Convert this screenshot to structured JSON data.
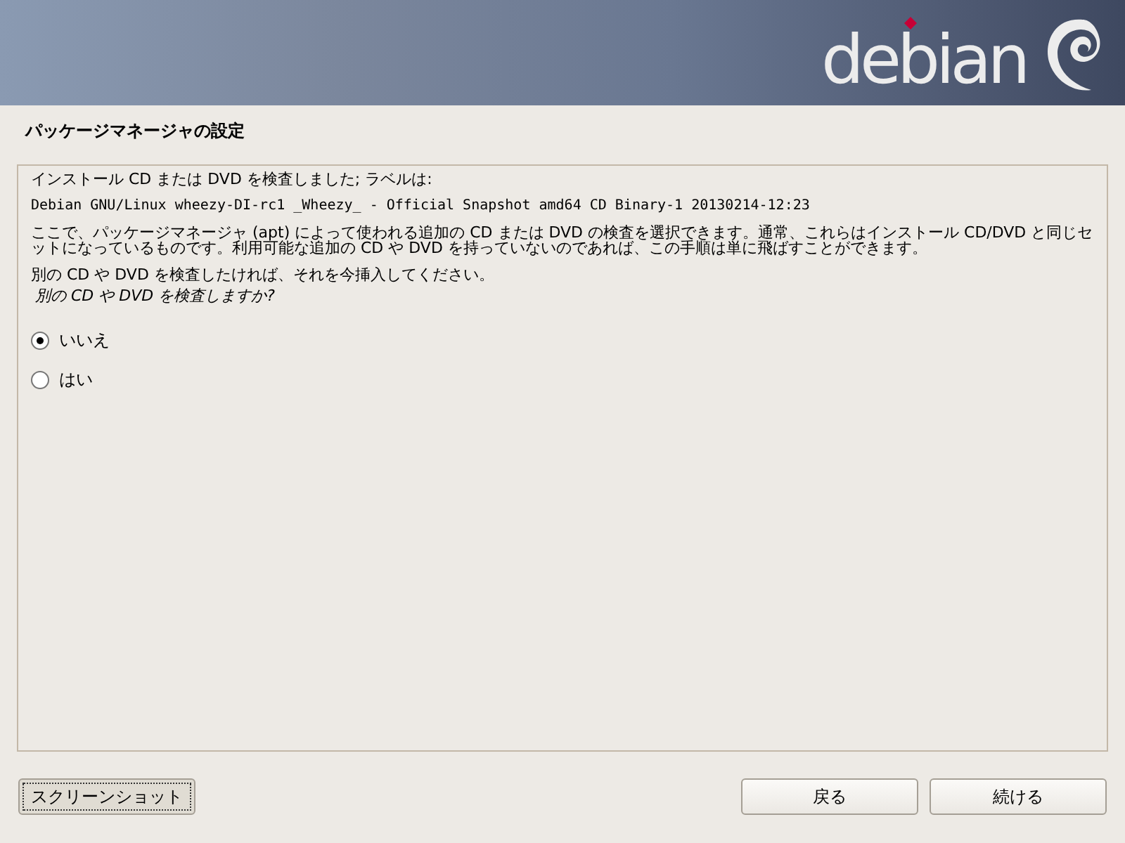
{
  "banner": {
    "logo_text": "debian"
  },
  "title": "パッケージマネージャの設定",
  "content": {
    "lines": [
      "インストール CD または DVD を検査しました; ラベルは:",
      "Debian GNU/Linux wheezy-DI-rc1 _Wheezy_ - Official Snapshot amd64 CD Binary-1 20130214-12:23",
      "ここで、パッケージマネージャ (apt) によって使われる追加の CD または DVD の検査を選択できます。通常、これらはインストール CD/DVD と同じセットになっているものです。利用可能な追加の CD や DVD を持っていないのであれば、この手順は単に飛ばすことができます。",
      "別の CD や DVD を検査したければ、それを今挿入してください。"
    ],
    "question": "別の CD や DVD を検査しますか?",
    "options": [
      {
        "label": "いいえ",
        "selected": true
      },
      {
        "label": "はい",
        "selected": false
      }
    ]
  },
  "buttons": [
    {
      "label": "スクリーンショット",
      "focused": true
    },
    {
      "label": "戻る",
      "focused": false
    },
    {
      "label": "続ける",
      "focused": false
    }
  ]
}
